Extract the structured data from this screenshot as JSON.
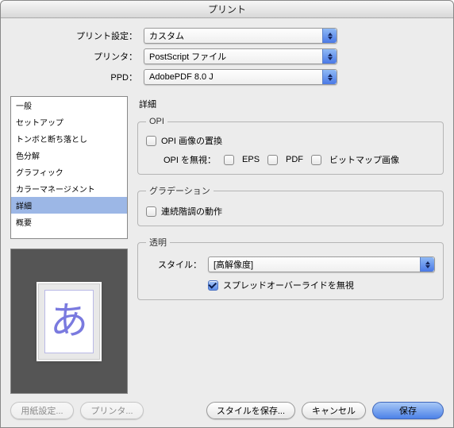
{
  "window": {
    "title": "プリント"
  },
  "top": {
    "preset_label": "プリント設定：",
    "printer_label": "プリンタ：",
    "ppd_label": "PPD：",
    "preset_value": "カスタム",
    "printer_value": "PostScript ファイル",
    "ppd_value": "AdobePDF 8.0 J"
  },
  "sidebar": {
    "items": [
      {
        "label": "一般"
      },
      {
        "label": "セットアップ"
      },
      {
        "label": "トンボと断ち落とし"
      },
      {
        "label": "色分解"
      },
      {
        "label": "グラフィック"
      },
      {
        "label": "カラーマネージメント"
      },
      {
        "label": "詳細"
      },
      {
        "label": "概要"
      }
    ],
    "selected_index": 6
  },
  "preview": {
    "glyph": "あ"
  },
  "detail": {
    "heading": "詳細",
    "opi": {
      "legend": "OPI",
      "replace_label": "OPI 画像の置換",
      "ignore_label": "OPI を無視：",
      "eps_label": "EPS",
      "pdf_label": "PDF",
      "bitmap_label": "ビットマップ画像"
    },
    "gradation": {
      "legend": "グラデーション",
      "continuous_label": "連続階調の動作"
    },
    "transparency": {
      "legend": "透明",
      "style_label": "スタイル：",
      "style_value": "[高解像度]",
      "override_label": "スプレッドオーバーライドを無視",
      "override_checked": true
    }
  },
  "footer": {
    "page_setup": "用紙設定...",
    "printer_btn": "プリンタ...",
    "save_style": "スタイルを保存...",
    "cancel": "キャンセル",
    "save": "保存"
  }
}
